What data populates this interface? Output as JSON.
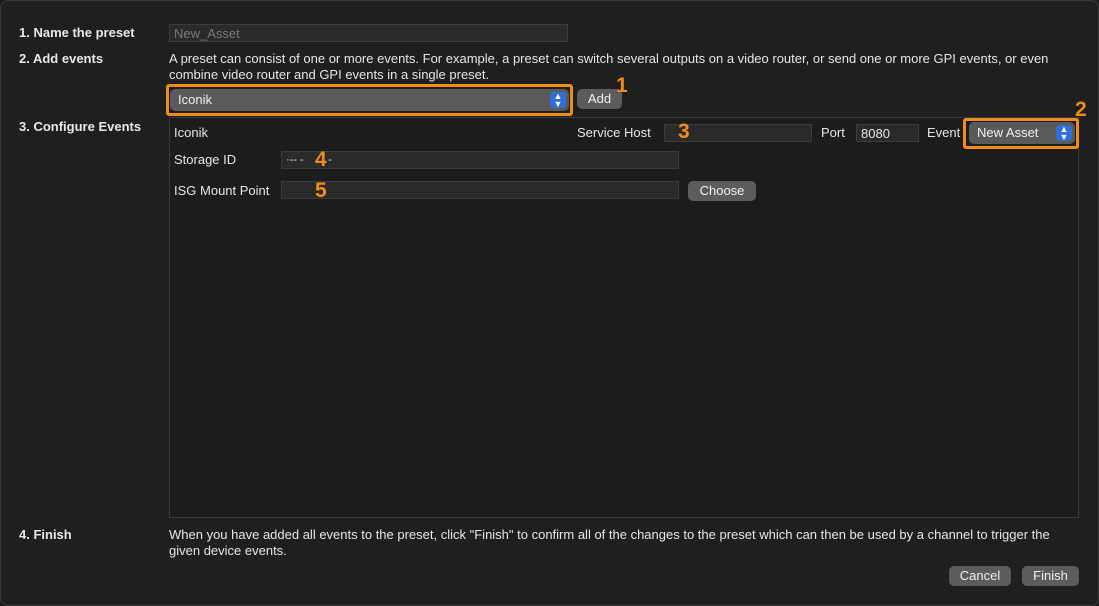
{
  "steps": {
    "name_preset": "1. Name the preset",
    "add_events": "2. Add events",
    "configure_events": "3. Configure Events",
    "finish": "4. Finish"
  },
  "preset_name": {
    "value": "New_Asset"
  },
  "add_events_description": "A preset can consist of one or more events. For example, a preset can switch several outputs on a video router, or send one or more GPI events, or even combine video router and GPI events in a single preset.",
  "event_type_popup": {
    "selected": "Iconik"
  },
  "add_button": "Add",
  "configure": {
    "device_name": "Iconik",
    "service_host_label": "Service Host",
    "service_host_value": "",
    "port_label": "Port",
    "port_value": "8080",
    "event_label": "Event",
    "event_selected": "New Asset",
    "storage_id_label": "Storage ID",
    "storage_id_value": "·-- -        -",
    "isg_mount_label": "ISG Mount Point",
    "isg_mount_value": "",
    "choose_button": "Choose"
  },
  "finish_description": "When you have added all events to the preset, click \"Finish\" to confirm all of the changes to the preset which can then be used by a channel to trigger the given device events.",
  "buttons": {
    "cancel": "Cancel",
    "finish": "Finish"
  },
  "annotations": [
    "1",
    "2",
    "3",
    "4",
    "5"
  ],
  "colors": {
    "highlight": "#f08c18",
    "popup_accent": "#2f6fd6"
  },
  "icons": {
    "popup_arrows": "up-down-chevron-icon"
  }
}
